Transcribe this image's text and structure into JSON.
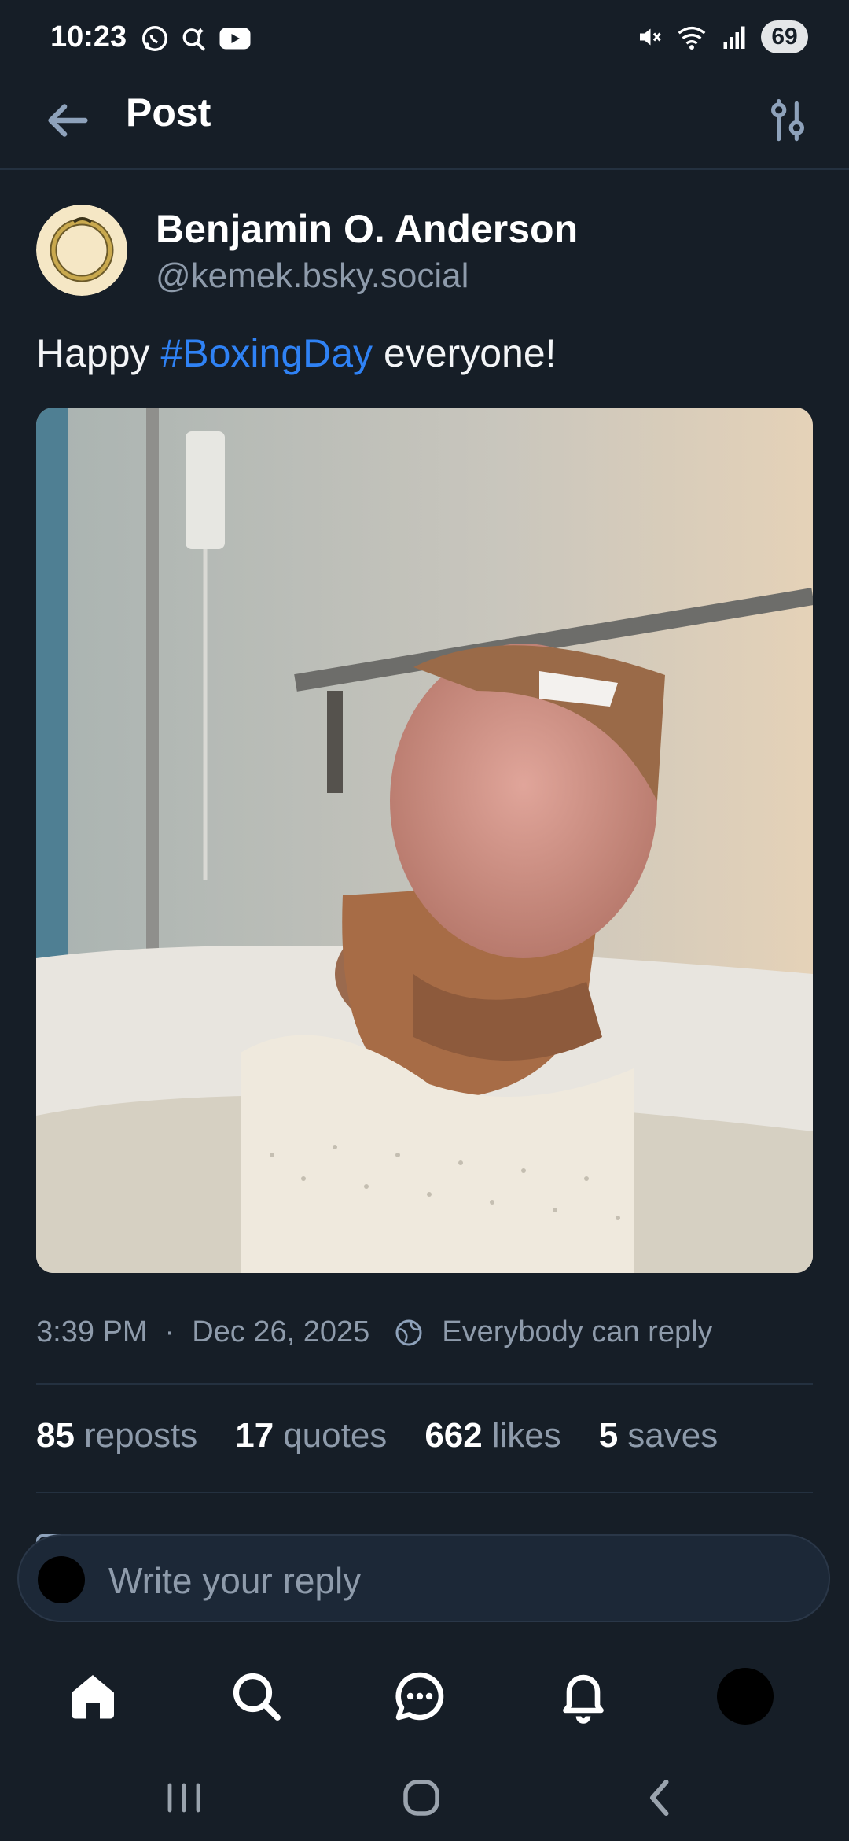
{
  "status_bar": {
    "time": "10:23",
    "battery": "69",
    "icons_left": [
      "whatsapp-icon",
      "search-sparkle-icon",
      "youtube-icon"
    ],
    "icons_right": [
      "mute-icon",
      "wifi-icon",
      "signal-icon"
    ]
  },
  "header": {
    "title": "Post",
    "back_icon": "arrow-left-icon",
    "settings_icon": "sliders-icon"
  },
  "post": {
    "author_name": "Benjamin O. Anderson",
    "author_handle": "@kemek.bsky.social",
    "text_before": "Happy ",
    "hashtag": "#BoxingDay",
    "text_after": " everyone!",
    "timestamp": "3:39 PM",
    "separator": "·",
    "date": "Dec 26, 2025",
    "reply_setting": "Everybody can reply"
  },
  "stats": {
    "reposts_count": "85",
    "reposts_label": "reposts",
    "quotes_count": "17",
    "quotes_label": "quotes",
    "likes_count": "662",
    "likes_label": "likes",
    "saves_count": "5",
    "saves_label": "saves"
  },
  "reply": {
    "placeholder": "Write your reply"
  },
  "tabbar": {
    "items": [
      "home-icon",
      "search-icon",
      "chat-icon",
      "bell-icon",
      "profile-avatar"
    ]
  },
  "navbar": {
    "items": [
      "recent-apps-icon",
      "home-button-icon",
      "back-icon"
    ]
  },
  "colors": {
    "background": "#161e27",
    "accent": "#2f82f5",
    "muted_text": "#8e9bab",
    "divider": "#243140"
  }
}
